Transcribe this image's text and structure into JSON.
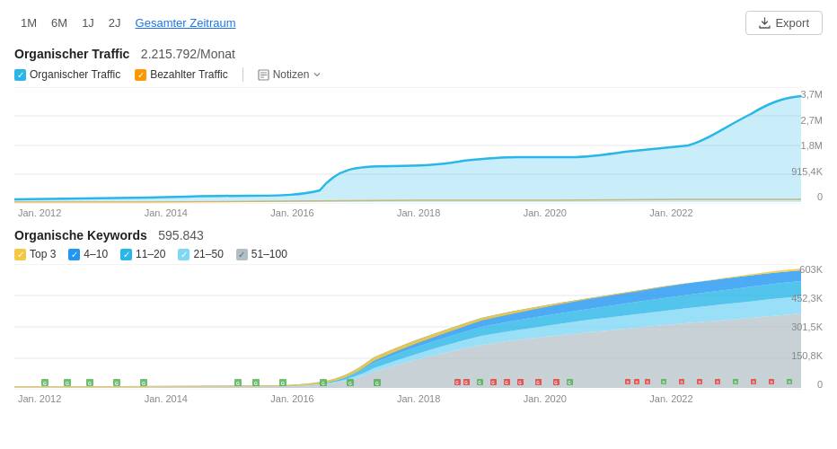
{
  "timeRange": {
    "buttons": [
      "1M",
      "6M",
      "1J",
      "2J",
      "Gesamter Zeitraum"
    ],
    "active": "Gesamter Zeitraum"
  },
  "exportButton": "Export",
  "traffic": {
    "title": "Organischer Traffic",
    "value": "2.215.792/Monat",
    "yLabels": [
      "3,7M",
      "2,7M",
      "1,8M",
      "915,4K",
      "0"
    ],
    "xLabels": [
      "Jan. 2012",
      "Jan. 2014",
      "Jan. 2016",
      "Jan. 2018",
      "Jan. 2020",
      "Jan. 2022",
      ""
    ],
    "legend": {
      "organic": "Organischer Traffic",
      "paid": "Bezahlter Traffic",
      "notes": "Notizen"
    }
  },
  "keywords": {
    "title": "Organische Keywords",
    "value": "595.843",
    "yLabels": [
      "603K",
      "452,3K",
      "301,5K",
      "150,8K",
      "0"
    ],
    "xLabels": [
      "Jan. 2012",
      "Jan. 2014",
      "Jan. 2016",
      "Jan. 2018",
      "Jan. 2020",
      "Jan. 2022",
      ""
    ],
    "legend": {
      "top3": "Top 3",
      "r4_10": "4–10",
      "r11_20": "11–20",
      "r21_50": "21–50",
      "r51_100": "51–100"
    }
  },
  "colors": {
    "organic": "#29b6e8",
    "paid": "#ff9800",
    "top3": "#f5c842",
    "r4_10": "#2196f3",
    "r11_20": "#29b6e8",
    "r21_50": "#80d8f5",
    "r51_100": "#b0bec5",
    "gridLine": "#e8e8e8",
    "accent": "#1a73e8"
  }
}
